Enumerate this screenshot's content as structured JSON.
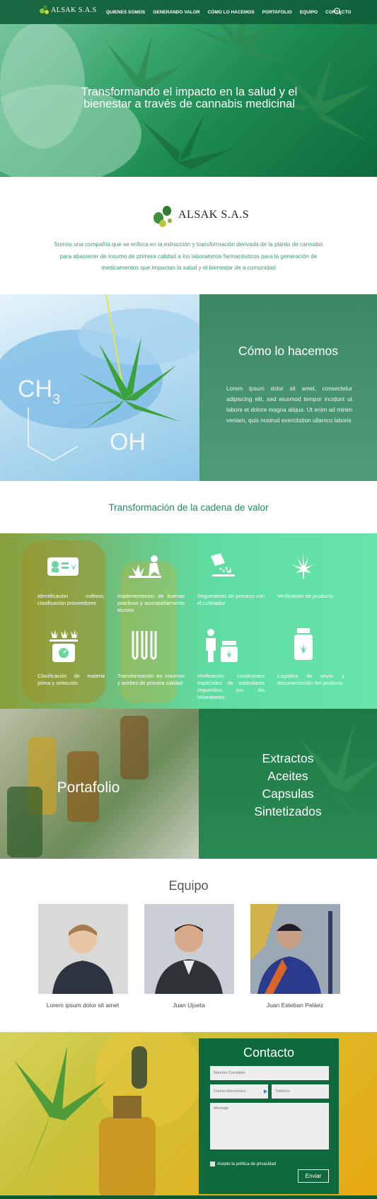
{
  "nav": {
    "logo_text": "ALSAK S.A.S",
    "items": [
      "QUIENES SOMOS",
      "GENERANDO VALOR",
      "CÓMO LO HACEMOS",
      "PORTAFOLIO",
      "EQUIPO",
      "CONTACTO"
    ],
    "search_icon": "search-icon"
  },
  "hero": {
    "title_line1": "Transformando el impacto en la salud y el",
    "title_line2": "bienestar a través de cannabis medicinal"
  },
  "about": {
    "brand": "ALSAK S.A.S",
    "line1": "Somos una compañía que se enfoca en la extracción y transformación derivada de la planta de cannabis",
    "line2": "para abastecer de insumo de primera calidad a los laboratorios farmacéuticos  para la generación de",
    "line3": "medicamentos  que impactan la salud y el bienestar de a comunidad"
  },
  "como": {
    "title": "Cómo lo hacemos",
    "text": "Lorem ipsum dolor sit amet, consectetur adipiscing elit, sed eiusmod tempor incidunt ut labore et dolore magna aliqua. Ut enim ad minim veniam, quis nostrud exercitation ullamco laboris",
    "image_labels": [
      "CH",
      "3",
      "OH"
    ]
  },
  "cadena": {
    "title": "Transformación de la cadena de valor"
  },
  "steps": [
    {
      "icon": "id-card-icon",
      "label": "Identificación cultivos, clasificación proveedores"
    },
    {
      "icon": "planting-hands-icon",
      "label": "Implementacion de buenas practicas y acompañamiento técnico"
    },
    {
      "icon": "seed-bag-icon",
      "label": "Seguimiento de proceso con el cultivador"
    },
    {
      "icon": "cannabis-leaf-icon",
      "label": "Verificación de producto"
    },
    {
      "icon": "scale-icon",
      "label": "Clasificación de materia prima y selección"
    },
    {
      "icon": "test-tubes-icon",
      "label": "Transformación en insumos y aceites de primera calidad"
    },
    {
      "icon": "person-bottle-icon",
      "label": "Verificación condiciones especiales de estándares requeridos por los laboratorios"
    },
    {
      "icon": "medicine-bottle-icon",
      "label": "Logistica de envío y documentación del producto"
    }
  ],
  "portafolio": {
    "title": "Portafolio",
    "items": [
      "Extractos",
      "Aceites",
      "Capsulas",
      "Sintetizados"
    ]
  },
  "equipo": {
    "title": "Equipo",
    "members": [
      {
        "name": "Lorem ipsum dolor sit amet"
      },
      {
        "name": "Juan Ujueta"
      },
      {
        "name": "Juan Esteban Peláez"
      }
    ]
  },
  "contacto": {
    "title": "Contacto",
    "name_placeholder": "Nombre Completo",
    "email_placeholder": "Correo Electrónico",
    "phone_placeholder": "Teléfono",
    "message_placeholder": "Mensaje",
    "privacy": "Acepto la política de privacidad",
    "send": "Enviar"
  },
  "colors": {
    "brand_green": "#0e6a3c",
    "accent_green": "#1b8f5f",
    "text_green": "#3d9b6d"
  }
}
